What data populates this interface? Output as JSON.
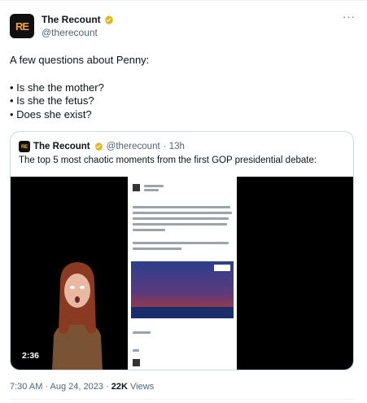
{
  "author": {
    "display_name": "The Recount",
    "handle": "@therecount",
    "avatar_text": "RE"
  },
  "more_menu": "···",
  "tweet": {
    "lines": [
      "A few questions about Penny:",
      "",
      "• Is she the mother?",
      "• Is she the fetus?",
      "• Does she exist?"
    ]
  },
  "quoted_tweet": {
    "display_name": "The Recount",
    "handle": "@therecount",
    "time": "· 13h",
    "avatar_text": "RE",
    "text": "The top 5 most chaotic moments from the first GOP presidential debate:",
    "video": {
      "duration": "2:36"
    }
  },
  "meta": {
    "time": "7:30 AM",
    "date": "Aug 24, 2023",
    "views_count": "22K",
    "views_label": "Views",
    "separator": "·"
  },
  "colors": {
    "accent_gold": "#f5a23a",
    "secondary_text": "#536471",
    "primary_text": "#0f1419",
    "verified_badge": "#e2b719"
  }
}
